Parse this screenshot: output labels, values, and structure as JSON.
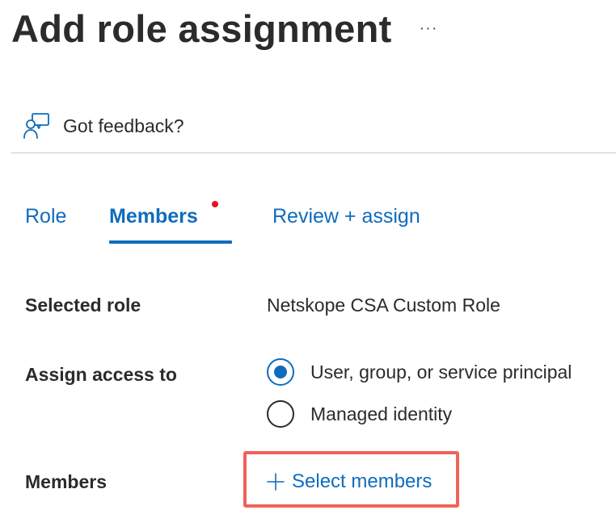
{
  "header": {
    "title": "Add role assignment",
    "more_label": "···"
  },
  "feedback": {
    "icon": "feedback-person-icon",
    "label": "Got feedback?"
  },
  "tabs": [
    {
      "label": "Role",
      "active": false
    },
    {
      "label": "Members",
      "active": true,
      "required_indicator": true
    },
    {
      "label": "Review + assign",
      "active": false
    }
  ],
  "form": {
    "selected_role": {
      "label": "Selected role",
      "value": "Netskope CSA Custom Role"
    },
    "assign_access": {
      "label": "Assign access to",
      "options": [
        {
          "label": "User, group, or service principal",
          "checked": true
        },
        {
          "label": "Managed identity",
          "checked": false
        }
      ]
    },
    "members": {
      "label": "Members",
      "action_label": "Select members",
      "action_icon": "plus-icon"
    }
  },
  "colors": {
    "accent": "#0f6cbd",
    "required_dot": "#e81123",
    "highlight_border": "#f0625a",
    "text": "#2b2b2b"
  }
}
